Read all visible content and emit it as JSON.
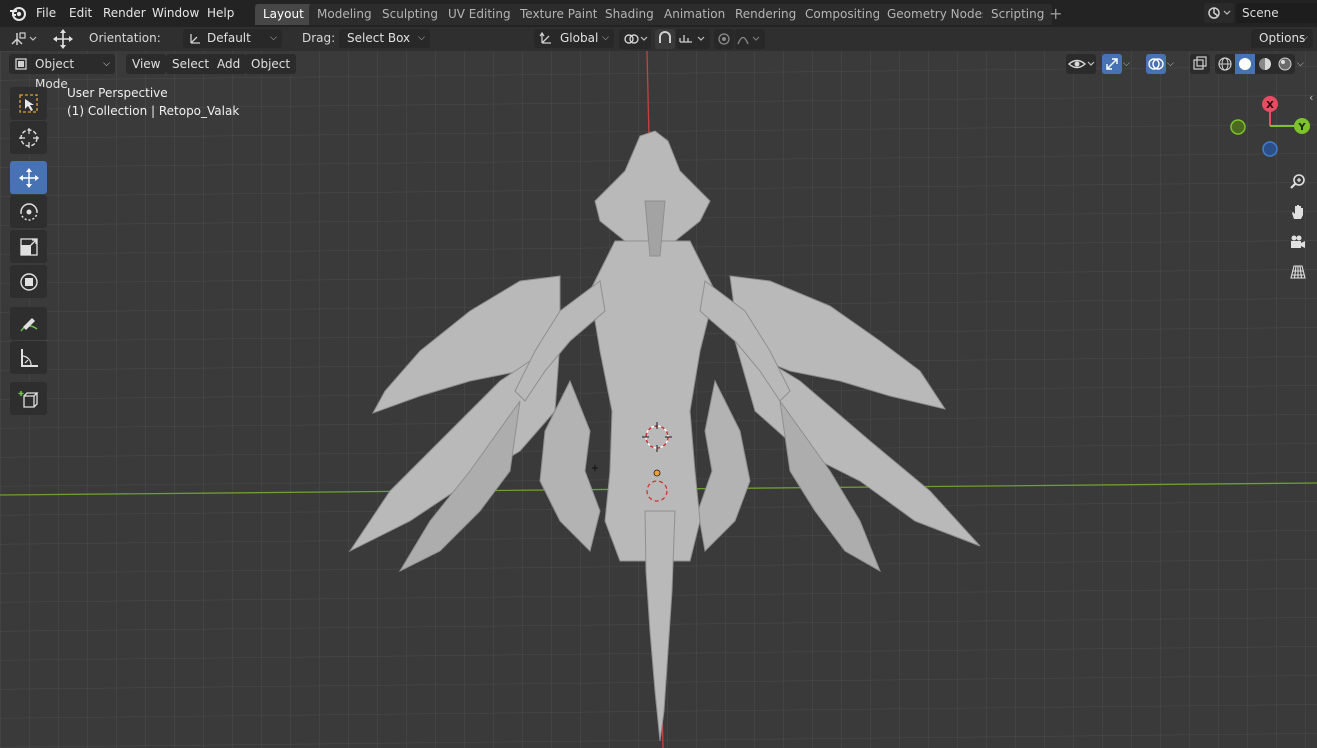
{
  "menubar": {
    "items": [
      "File",
      "Edit",
      "Render",
      "Window",
      "Help"
    ],
    "workspace_tabs": [
      "Layout",
      "Modeling",
      "Sculpting",
      "UV Editing",
      "Texture Paint",
      "Shading",
      "Animation",
      "Rendering",
      "Compositing",
      "Geometry Nodes",
      "Scripting"
    ],
    "active_tab": "Layout",
    "add_tab_icon": "plus-icon",
    "scene": "Scene"
  },
  "tool_header": {
    "orientation_label": "Orientation:",
    "orientation_value": "Default",
    "drag_label": "Drag:",
    "drag_value": "Select Box",
    "transform_orientation": "Global",
    "options_label": "Options"
  },
  "viewport_header": {
    "mode": "Object Mode",
    "menus": [
      "View",
      "Select",
      "Add",
      "Object"
    ]
  },
  "viewport": {
    "perspective_text": "User Perspective",
    "collection_text": "(1) Collection | Retopo_Valak",
    "gizmo": {
      "x_label": "X",
      "y_label": "Y",
      "x_color": "#e84b63",
      "y_color": "#7dc22a",
      "z_color": "#3f7fd1"
    },
    "axis_colors": {
      "x_axis": "#c84040",
      "y_axis": "#6d9e2e"
    }
  },
  "toolbar": {
    "tools": [
      "select-box-tool",
      "cursor-tool",
      "move-tool",
      "rotate-tool",
      "scale-tool",
      "transform-tool",
      "annotate-tool",
      "measure-tool",
      "add-cube-tool"
    ],
    "active_tool": "move-tool"
  },
  "nav_controls": [
    "zoom-icon",
    "hand-pan-icon",
    "camera-icon",
    "grid-perspective-icon"
  ]
}
